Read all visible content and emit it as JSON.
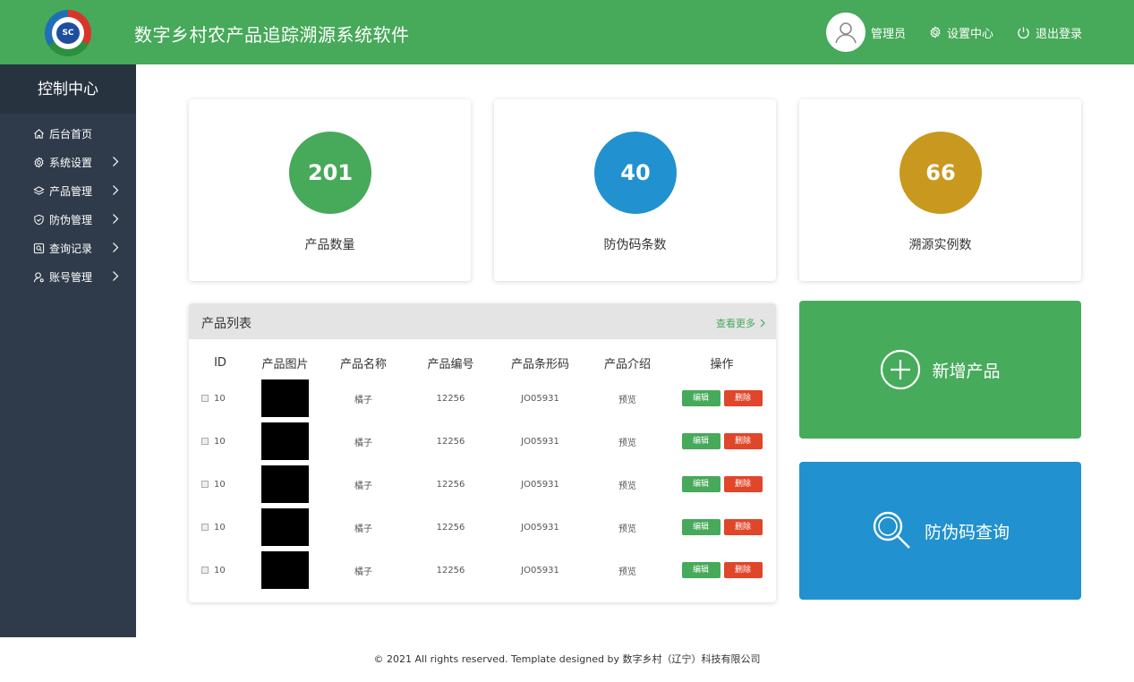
{
  "header": {
    "logo_text": "SC",
    "title": "数字乡村农产品追踪溯源系统软件",
    "user_label": "管理员",
    "settings_label": "设置中心",
    "logout_label": "退出登录"
  },
  "sidebar": {
    "title": "控制中心",
    "items": [
      {
        "label": "后台首页",
        "icon": "home-icon",
        "has_submenu": false
      },
      {
        "label": "系统设置",
        "icon": "gear-icon",
        "has_submenu": true
      },
      {
        "label": "产品管理",
        "icon": "layers-icon",
        "has_submenu": true
      },
      {
        "label": "防伪管理",
        "icon": "shield-icon",
        "has_submenu": true
      },
      {
        "label": "查询记录",
        "icon": "search-record-icon",
        "has_submenu": true
      },
      {
        "label": "账号管理",
        "icon": "user-icon",
        "has_submenu": true
      }
    ]
  },
  "stats": [
    {
      "value": "201",
      "label": "产品数量",
      "color": "#47a95a"
    },
    {
      "value": "40",
      "label": "防伪码条数",
      "color": "#2291cf"
    },
    {
      "value": "66",
      "label": "溯源实例数",
      "color": "#c9981f"
    }
  ],
  "product_list": {
    "title": "产品列表",
    "more_label": "查看更多",
    "columns": [
      "ID",
      "产品图片",
      "产品名称",
      "产品编号",
      "产品条形码",
      "产品介绍",
      "操作"
    ],
    "rows": [
      {
        "id": "10",
        "name": "橘子",
        "number": "12256",
        "barcode": "JO05931",
        "intro": "预览",
        "edit": "编辑",
        "delete": "删除"
      },
      {
        "id": "10",
        "name": "橘子",
        "number": "12256",
        "barcode": "JO05931",
        "intro": "预览",
        "edit": "编辑",
        "delete": "删除"
      },
      {
        "id": "10",
        "name": "橘子",
        "number": "12256",
        "barcode": "JO05931",
        "intro": "预览",
        "edit": "编辑",
        "delete": "删除"
      },
      {
        "id": "10",
        "name": "橘子",
        "number": "12256",
        "barcode": "JO05931",
        "intro": "预览",
        "edit": "编辑",
        "delete": "删除"
      },
      {
        "id": "10",
        "name": "橘子",
        "number": "12256",
        "barcode": "JO05931",
        "intro": "预览",
        "edit": "编辑",
        "delete": "删除"
      }
    ]
  },
  "actions": {
    "add_product_label": "新增产品",
    "query_label": "防伪码查询"
  },
  "footer": {
    "text": "© 2021 All rights reserved. Template designed by 数字乡村（辽宁）科技有限公司"
  },
  "colors": {
    "brand_green": "#47a95a",
    "sidebar_bg": "#2f3b4a",
    "accent_blue": "#2291cf",
    "accent_gold": "#c9981f",
    "danger_red": "#e0462a"
  }
}
